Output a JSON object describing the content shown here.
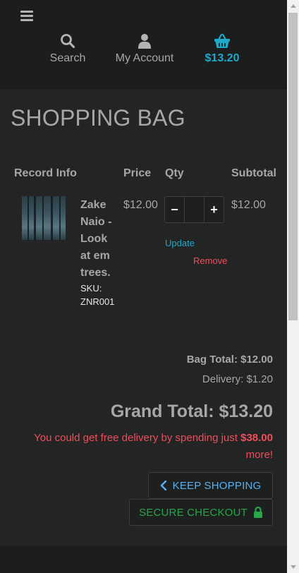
{
  "header": {
    "nav": {
      "search_label": "Search",
      "account_label": "My Account",
      "cart_total": "$13.20"
    }
  },
  "main": {
    "title": "SHOPPING BAG",
    "columns": {
      "info": "Record Info",
      "price": "Price",
      "qty": "Qty",
      "subtotal": "Subtotal"
    },
    "item": {
      "title": "Zake Naio - Look at em trees.",
      "sku": "SKU: ZNR001",
      "price": "$12.00",
      "quantity": "",
      "subtotal": "$12.00",
      "minus_label": "−",
      "plus_label": "+",
      "update_label": "Update",
      "remove_label": "Remove"
    },
    "summary": {
      "bag_total_label": "Bag Total:",
      "bag_total_value": "$12.00",
      "delivery_label": "Delivery:",
      "delivery_value": "$1.20",
      "grand_total_label": "Grand Total:",
      "grand_total_value": "$13.20",
      "free_delivery_prefix": "You could get free delivery by spending just",
      "free_delivery_amount": "$38.00",
      "free_delivery_suffix": "more!"
    },
    "buttons": {
      "keep_shopping": "KEEP SHOPPING",
      "secure_checkout": "SECURE CHECKOUT"
    }
  },
  "colors": {
    "accent_cyan": "#1fa9c9",
    "danger_red": "#f14d5b",
    "link_blue": "#5ab0f0",
    "checkout_green": "#27a64a"
  },
  "icons": [
    "hamburger-icon",
    "search-icon",
    "user-icon",
    "basket-icon",
    "chevron-left-icon",
    "lock-icon"
  ]
}
